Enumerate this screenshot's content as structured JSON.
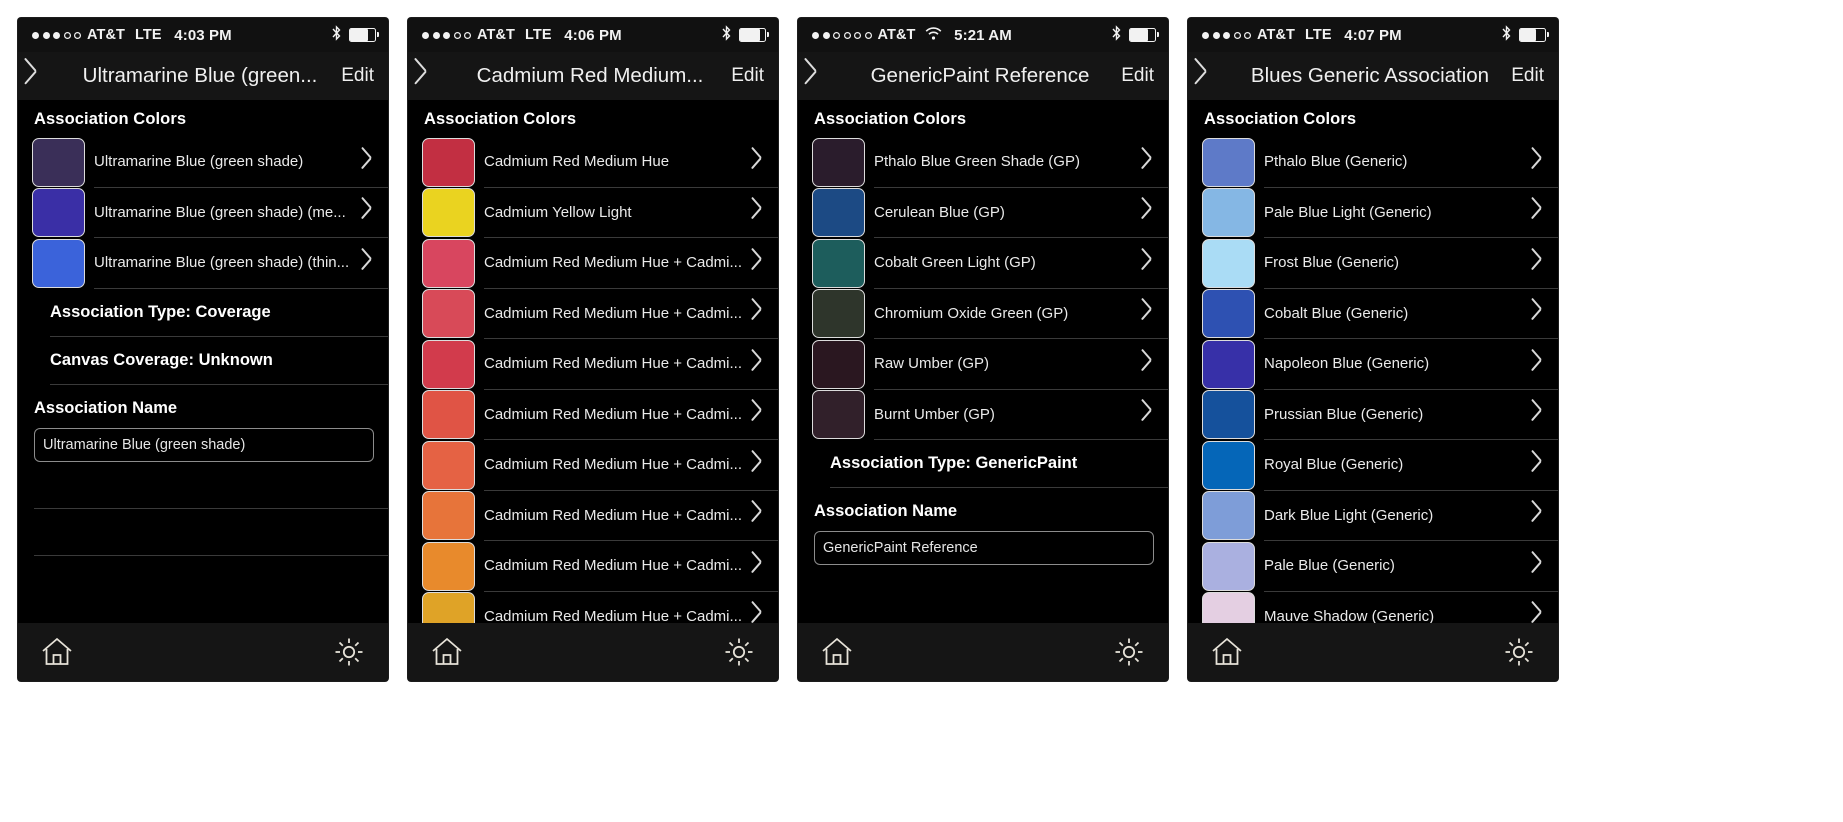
{
  "app": {
    "section_header": "Association Colors",
    "edit_label": "Edit",
    "home_icon": "home-icon",
    "gear_icon": "gear-icon",
    "back_icon": "chevron-left-icon",
    "disclosure_icon": "chevron-right-icon",
    "bluetooth_icon": "bluetooth-icon",
    "battery_icon": "battery-icon",
    "wifi_icon": "wifi-icon"
  },
  "panels": [
    {
      "status": {
        "carrier": "AT&T",
        "network": "LTE",
        "time": "4:03 PM",
        "signal_filled": 3,
        "signal_total": 5,
        "network_type": "lte",
        "battery_pct": 72
      },
      "title": "Ultramarine Blue (green...",
      "colors": [
        {
          "name": "Ultramarine Blue (green shade)",
          "hex": "#3a2f58"
        },
        {
          "name": "Ultramarine Blue (green shade) (me...",
          "hex": "#3a2fa6"
        },
        {
          "name": "Ultramarine Blue (green shade) (thin...",
          "hex": "#3b63da"
        }
      ],
      "info": [
        "Association Type: Coverage",
        "Canvas Coverage: Unknown"
      ],
      "field_label": "Association Name",
      "field_value": "Ultramarine Blue (green shade)",
      "blank_rows": 2
    },
    {
      "status": {
        "carrier": "AT&T",
        "network": "LTE",
        "time": "4:06 PM",
        "signal_filled": 3,
        "signal_total": 5,
        "network_type": "lte",
        "battery_pct": 78
      },
      "title": "Cadmium Red Medium...",
      "colors": [
        {
          "name": "Cadmium Red Medium Hue",
          "hex": "#c22f42"
        },
        {
          "name": "Cadmium Yellow Light",
          "hex": "#ead320"
        },
        {
          "name": "Cadmium Red Medium Hue + Cadmi...",
          "hex": "#d8465f"
        },
        {
          "name": "Cadmium Red Medium Hue + Cadmi...",
          "hex": "#d84a58"
        },
        {
          "name": "Cadmium Red Medium Hue + Cadmi...",
          "hex": "#d23b4c"
        },
        {
          "name": "Cadmium Red Medium Hue + Cadmi...",
          "hex": "#e05445"
        },
        {
          "name": "Cadmium Red Medium Hue + Cadmi...",
          "hex": "#e56244"
        },
        {
          "name": "Cadmium Red Medium Hue + Cadmi...",
          "hex": "#e7743a"
        },
        {
          "name": "Cadmium Red Medium Hue + Cadmi...",
          "hex": "#e88a2c"
        },
        {
          "name": "Cadmium Red Medium Hue + Cadmi...",
          "hex": "#dfa327"
        }
      ],
      "info": [],
      "field_label": "",
      "field_value": "",
      "blank_rows": 0
    },
    {
      "status": {
        "carrier": "AT&T",
        "network": "",
        "time": "5:21 AM",
        "signal_filled": 2,
        "signal_total": 6,
        "network_type": "wifi",
        "battery_pct": 70
      },
      "title": "GenericPaint Reference",
      "colors": [
        {
          "name": "Pthalo Blue Green Shade (GP)",
          "hex": "#2a1c2c"
        },
        {
          "name": "Cerulean Blue (GP)",
          "hex": "#1c4a84"
        },
        {
          "name": "Cobalt Green Light (GP)",
          "hex": "#1d5d5c"
        },
        {
          "name": "Chromium Oxide Green (GP)",
          "hex": "#2e352b"
        },
        {
          "name": "Raw Umber (GP)",
          "hex": "#2a1720"
        },
        {
          "name": "Burnt Umber (GP)",
          "hex": "#31202a"
        }
      ],
      "info": [
        "Association Type: GenericPaint"
      ],
      "field_label": "Association Name",
      "field_value": "GenericPaint Reference",
      "blank_rows": 0
    },
    {
      "status": {
        "carrier": "AT&T",
        "network": "LTE",
        "time": "4:07 PM",
        "signal_filled": 3,
        "signal_total": 5,
        "network_type": "lte",
        "battery_pct": 62
      },
      "title": "Blues Generic Association",
      "colors": [
        {
          "name": "Pthalo Blue (Generic)",
          "hex": "#5e7ac8"
        },
        {
          "name": "Pale Blue Light (Generic)",
          "hex": "#85b7e4"
        },
        {
          "name": "Frost Blue (Generic)",
          "hex": "#aadcf5"
        },
        {
          "name": "Cobalt Blue (Generic)",
          "hex": "#2e51b2"
        },
        {
          "name": "Napoleon Blue (Generic)",
          "hex": "#3730a8"
        },
        {
          "name": "Prussian Blue (Generic)",
          "hex": "#15519c"
        },
        {
          "name": "Royal Blue (Generic)",
          "hex": "#0566b8"
        },
        {
          "name": "Dark Blue Light (Generic)",
          "hex": "#7e9dd8"
        },
        {
          "name": "Pale Blue (Generic)",
          "hex": "#aab0e0"
        },
        {
          "name": "Mauve Shadow (Generic)",
          "hex": "#e4cfe2"
        }
      ],
      "info": [],
      "field_label": "",
      "field_value": "",
      "blank_rows": 0
    }
  ]
}
